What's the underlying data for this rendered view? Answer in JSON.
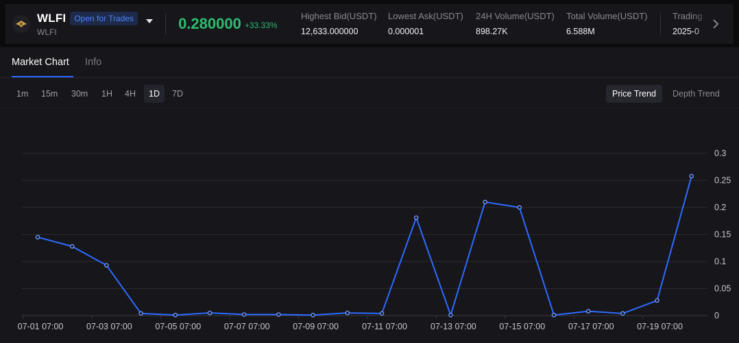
{
  "header": {
    "coin_name": "WLFI",
    "coin_sub": "WLFI",
    "badge": "Open for Trades",
    "price": "0.280000",
    "change": "+33.33%",
    "icon": "wlfi-logo-icon",
    "stats": [
      {
        "label": "Highest Bid(USDT)",
        "value": "12,633.000000"
      },
      {
        "label": "Lowest Ask(USDT)",
        "value": "0.000001"
      },
      {
        "label": "24H Volume(USDT)",
        "value": "898.27K"
      },
      {
        "label": "Total Volume(USDT)",
        "value": "6.588M"
      },
      {
        "label": "Trading",
        "value": "2025-0"
      }
    ]
  },
  "tabs": {
    "market_chart": "Market Chart",
    "info": "Info"
  },
  "intervals": [
    "1m",
    "15m",
    "30m",
    "1H",
    "4H",
    "1D",
    "7D"
  ],
  "active_interval": "1D",
  "modes": {
    "price_trend": "Price Trend",
    "depth_trend": "Depth Trend"
  },
  "active_mode": "Price Trend",
  "colors": {
    "up": "#2ebd6f",
    "accent": "#2f6bff",
    "line": "#2f6bff",
    "badge_text": "#4b84ff"
  },
  "chart_data": {
    "type": "line",
    "x": [
      "07-01 07:00",
      "07-02 07:00",
      "07-03 07:00",
      "07-04 07:00",
      "07-05 07:00",
      "07-06 07:00",
      "07-07 07:00",
      "07-08 07:00",
      "07-09 07:00",
      "07-10 07:00",
      "07-11 07:00",
      "07-12 07:00",
      "07-13 07:00",
      "07-14 07:00",
      "07-15 07:00",
      "07-16 07:00",
      "07-17 07:00",
      "07-18 07:00",
      "07-19 07:00",
      "07-20 07:00"
    ],
    "series": [
      {
        "values": [
          0.145,
          0.128,
          0.093,
          0.004,
          0.001,
          0.005,
          0.002,
          0.002,
          0.001,
          0.005,
          0.004,
          0.181,
          0.001,
          0.21,
          0.2,
          0.001,
          0.008,
          0.004,
          0.028,
          0.258
        ]
      }
    ],
    "xticks": [
      "07-01 07:00",
      "07-03 07:00",
      "07-05 07:00",
      "07-07 07:00",
      "07-09 07:00",
      "07-11 07:00",
      "07-13 07:00",
      "07-15 07:00",
      "07-17 07:00",
      "07-19 07:00"
    ],
    "yticks": [
      "0",
      "0.05",
      "0.1",
      "0.15",
      "0.2",
      "0.25",
      "0.3"
    ],
    "ylim": [
      0,
      0.3
    ],
    "grid": true,
    "axis_position": "right"
  }
}
